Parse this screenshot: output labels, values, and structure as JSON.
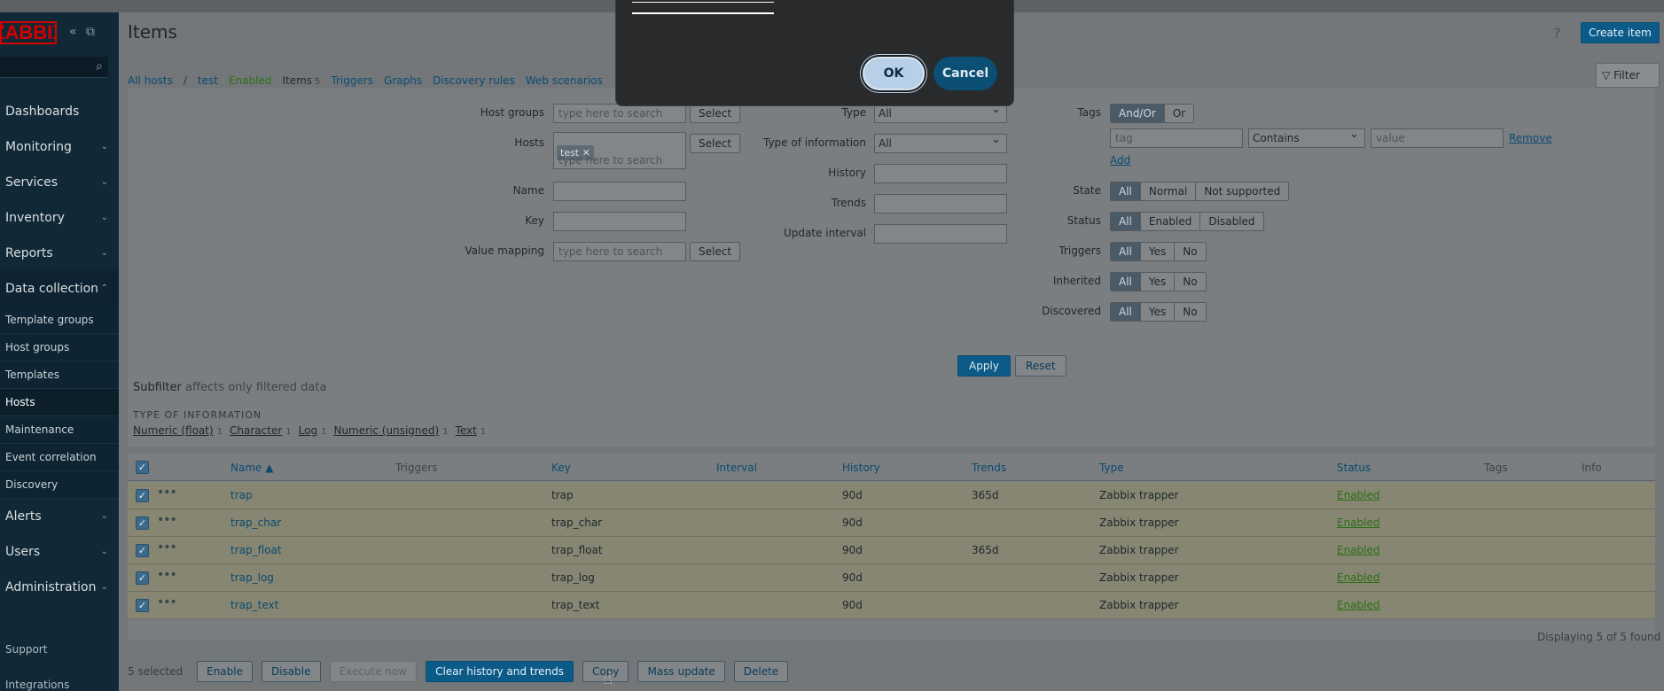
{
  "app": {
    "logo_text": "ZABBIX"
  },
  "sidebar": {
    "search_icon": "search-icon",
    "menu": [
      {
        "label": "Dashboards"
      },
      {
        "label": "Monitoring"
      },
      {
        "label": "Services"
      },
      {
        "label": "Inventory"
      },
      {
        "label": "Reports"
      },
      {
        "label": "Data collection"
      }
    ],
    "submenu": [
      {
        "label": "Template groups"
      },
      {
        "label": "Host groups"
      },
      {
        "label": "Templates"
      },
      {
        "label": "Hosts"
      },
      {
        "label": "Maintenance"
      },
      {
        "label": "Event correlation"
      },
      {
        "label": "Discovery"
      }
    ],
    "menu2": [
      {
        "label": "Alerts"
      },
      {
        "label": "Users"
      },
      {
        "label": "Administration"
      }
    ],
    "bottom": [
      {
        "label": "Support"
      },
      {
        "label": "Integrations"
      }
    ]
  },
  "header": {
    "title": "Items",
    "help": "?",
    "create_label": "Create item"
  },
  "nav": {
    "all_hosts": "All hosts",
    "sep": "/",
    "host": "test",
    "host_status": "Enabled",
    "items": "Items",
    "items_count": "5",
    "triggers": "Triggers",
    "graphs": "Graphs",
    "discovery": "Discovery rules",
    "web": "Web scenarios",
    "filter": "Filter"
  },
  "filter": {
    "host_groups_label": "Host groups",
    "host_groups_placeholder": "type here to search",
    "select": "Select",
    "hosts_label": "Hosts",
    "host_chip": "test ✕",
    "hosts_placeholder": "type here to search",
    "name_label": "Name",
    "key_label": "Key",
    "value_mapping_label": "Value mapping",
    "value_mapping_placeholder": "type here to search",
    "type_label": "Type",
    "type_value": "All",
    "toi_label": "Type of information",
    "toi_value": "All",
    "history_label": "History",
    "trends_label": "Trends",
    "update_interval_label": "Update interval",
    "tags_label": "Tags",
    "tags_andor": "And/Or",
    "tags_or": "Or",
    "tag_placeholder": "tag",
    "tag_op": "Contains",
    "tag_value_placeholder": "value",
    "remove": "Remove",
    "add": "Add",
    "state_label": "State",
    "state_opts": [
      "All",
      "Normal",
      "Not supported"
    ],
    "status_label": "Status",
    "status_opts": [
      "All",
      "Enabled",
      "Disabled"
    ],
    "triggers_label": "Triggers",
    "inherited_label": "Inherited",
    "discovered_label": "Discovered",
    "yn_opts": [
      "All",
      "Yes",
      "No"
    ],
    "apply": "Apply",
    "reset": "Reset"
  },
  "subfilter": {
    "title": "Subfilter",
    "note": "affects only filtered data",
    "section": "TYPE OF INFORMATION",
    "items": [
      {
        "label": "Numeric (float)",
        "count": "1"
      },
      {
        "label": "Character",
        "count": "1"
      },
      {
        "label": "Log",
        "count": "1"
      },
      {
        "label": "Numeric (unsigned)",
        "count": "1"
      },
      {
        "label": "Text",
        "count": "1"
      }
    ]
  },
  "table": {
    "headers": {
      "name": "Name ▲",
      "triggers": "Triggers",
      "key": "Key",
      "interval": "Interval",
      "history": "History",
      "trends": "Trends",
      "type": "Type",
      "status": "Status",
      "tags": "Tags",
      "info": "Info"
    },
    "rows": [
      {
        "name": "trap",
        "key": "trap",
        "history": "90d",
        "trends": "365d",
        "type": "Zabbix trapper",
        "status": "Enabled"
      },
      {
        "name": "trap_char",
        "key": "trap_char",
        "history": "90d",
        "trends": "",
        "type": "Zabbix trapper",
        "status": "Enabled"
      },
      {
        "name": "trap_float",
        "key": "trap_float",
        "history": "90d",
        "trends": "365d",
        "type": "Zabbix trapper",
        "status": "Enabled"
      },
      {
        "name": "trap_log",
        "key": "trap_log",
        "history": "90d",
        "trends": "",
        "type": "Zabbix trapper",
        "status": "Enabled"
      },
      {
        "name": "trap_text",
        "key": "trap_text",
        "history": "90d",
        "trends": "",
        "type": "Zabbix trapper",
        "status": "Enabled"
      }
    ],
    "displaying": "Displaying 5 of 5 found"
  },
  "footer": {
    "selected": "5 selected",
    "enable": "Enable",
    "disable": "Disable",
    "execute": "Execute now",
    "clear": "Clear history and trends",
    "copy": "Copy",
    "mass_update": "Mass update",
    "delete": "Delete"
  },
  "dialog": {
    "ok": "OK",
    "cancel": "Cancel"
  }
}
